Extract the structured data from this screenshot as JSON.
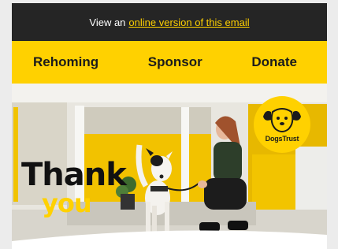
{
  "top_bar": {
    "text": "View an",
    "link": "online version of this email"
  },
  "nav": {
    "items": [
      "Rehoming",
      "Sponsor",
      "Donate"
    ]
  },
  "hero": {
    "headline_line1": "Thank",
    "headline_line2": "you",
    "logo_text": "DogsTrust"
  },
  "colors": {
    "brand_yellow": "#ffd100",
    "dark_bar": "#252525"
  }
}
